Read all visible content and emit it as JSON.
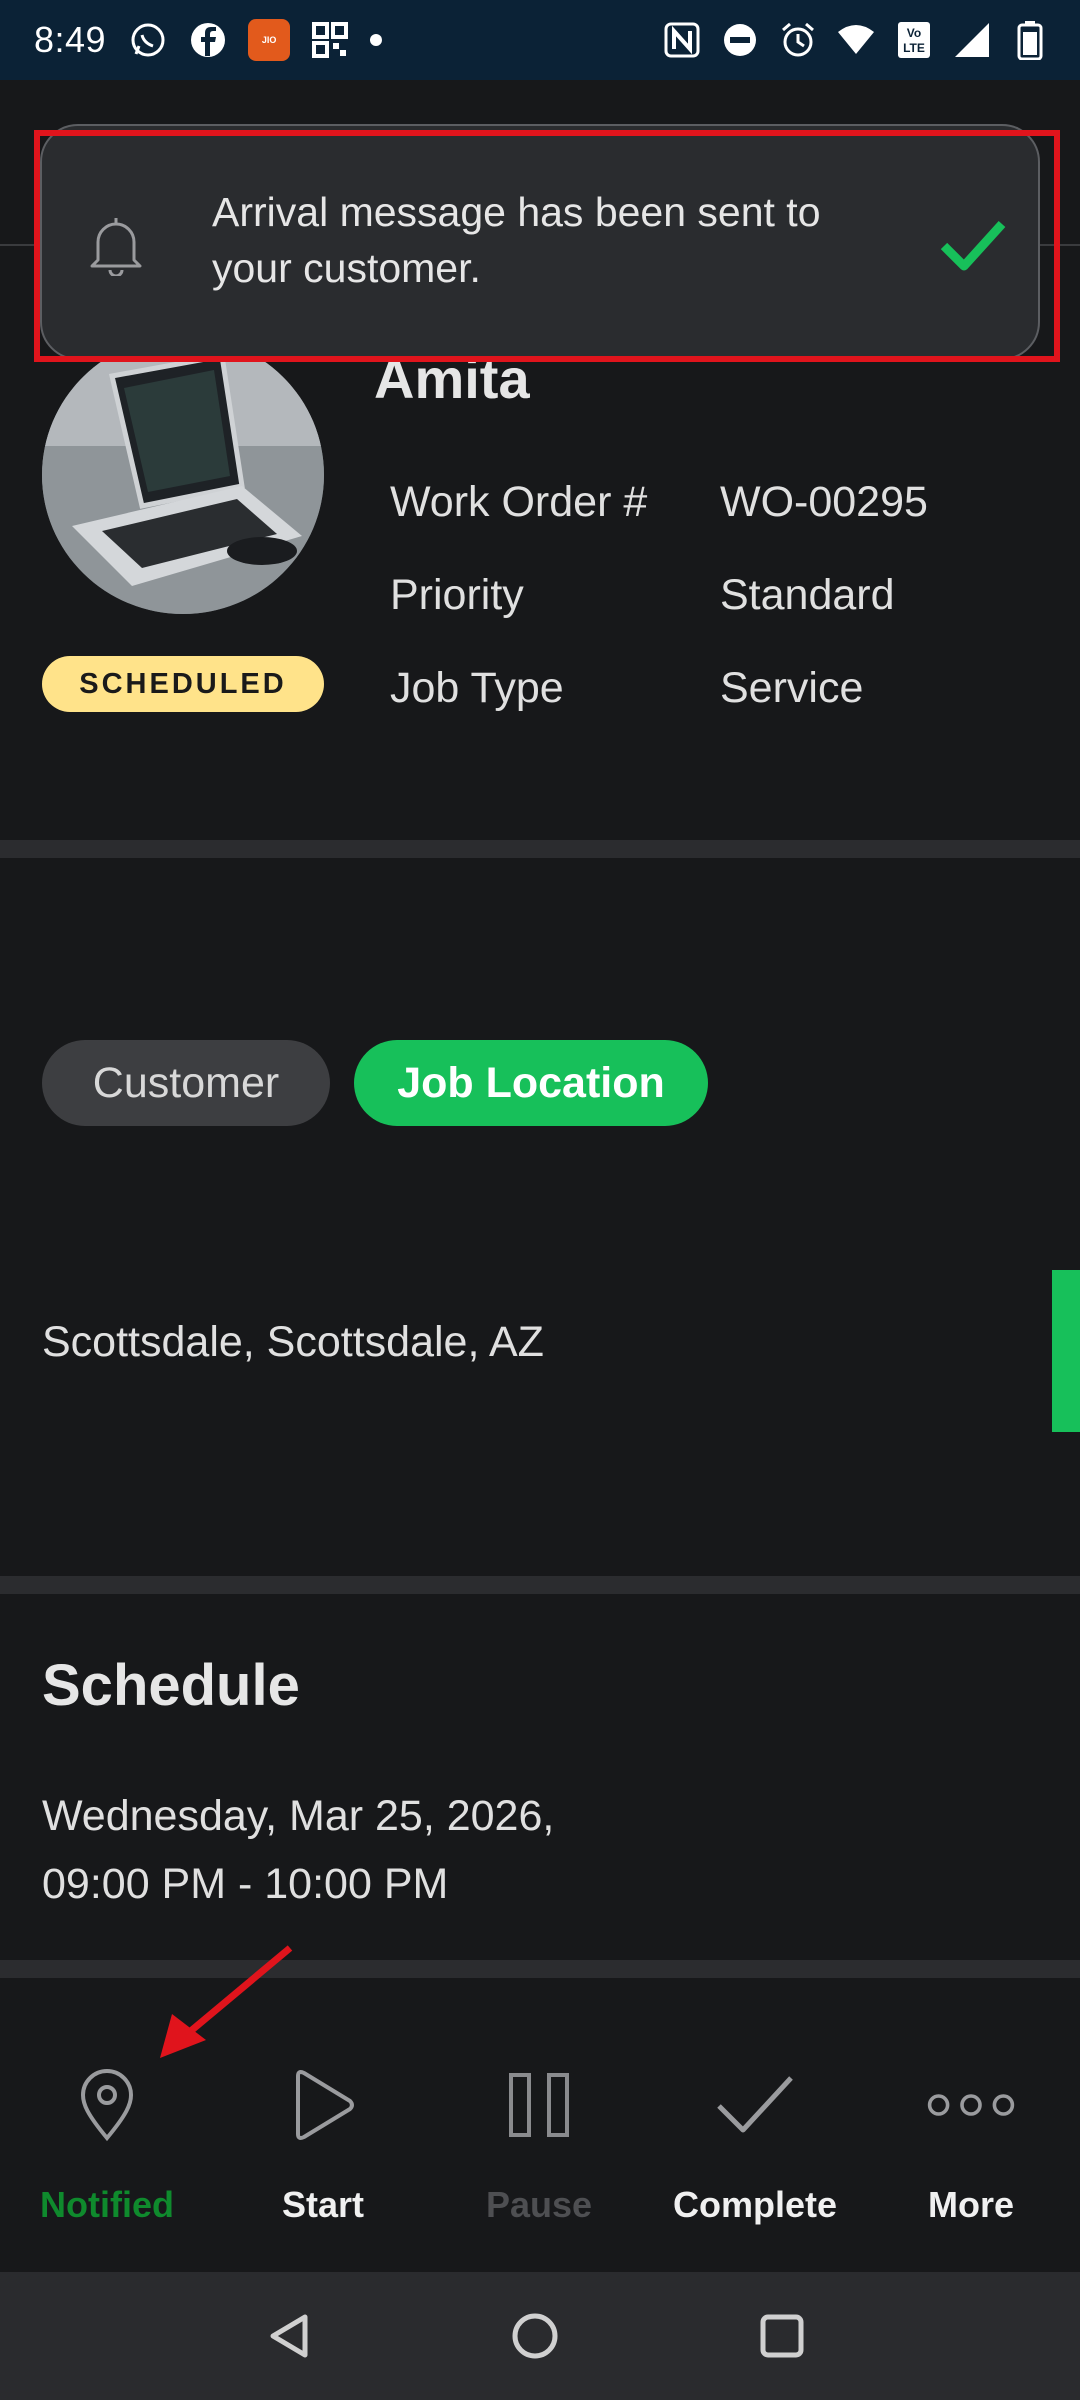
{
  "status_bar": {
    "time": "8:49",
    "app_icon_text": "JIO",
    "icons_left": [
      "whatsapp-icon",
      "facebook-icon",
      "jio-app-icon",
      "qr-icon",
      "dot-icon"
    ],
    "icons_right": [
      "nfc-icon",
      "dnd-icon",
      "alarm-icon",
      "wifi-icon",
      "volte-icon",
      "signal-icon",
      "battery-icon"
    ]
  },
  "toast": {
    "message": "Arrival message has been sent to your customer.",
    "icon": "bell-icon",
    "status_icon": "check-icon",
    "accent": "#17c05a",
    "highlight_color": "#e0141c"
  },
  "work_order": {
    "customer_name": "Amita",
    "status": "SCHEDULED",
    "fields": [
      {
        "label": "Work Order #",
        "value": "WO-00295"
      },
      {
        "label": "Priority",
        "value": "Standard"
      },
      {
        "label": "Job Type",
        "value": "Service"
      }
    ]
  },
  "location": {
    "tabs": [
      {
        "label": "Customer",
        "active": false
      },
      {
        "label": "Job Location",
        "active": true
      }
    ],
    "address": "Scottsdale, Scottsdale, AZ"
  },
  "schedule": {
    "title": "Schedule",
    "date": "Wednesday, Mar 25, 2026,",
    "time": "09:00 PM - 10:00 PM"
  },
  "actions": [
    {
      "label": "Notified",
      "icon": "location-pin-icon",
      "state": "active"
    },
    {
      "label": "Start",
      "icon": "play-icon",
      "state": "enabled"
    },
    {
      "label": "Pause",
      "icon": "pause-icon",
      "state": "disabled"
    },
    {
      "label": "Complete",
      "icon": "check-icon",
      "state": "enabled"
    },
    {
      "label": "More",
      "icon": "more-dots-icon",
      "state": "enabled"
    }
  ],
  "colors": {
    "background": "#17181a",
    "accent_green": "#17c05a",
    "notified_green": "#0f8a2d",
    "badge_yellow": "#ffe38a",
    "annotation_red": "#e0141c"
  }
}
